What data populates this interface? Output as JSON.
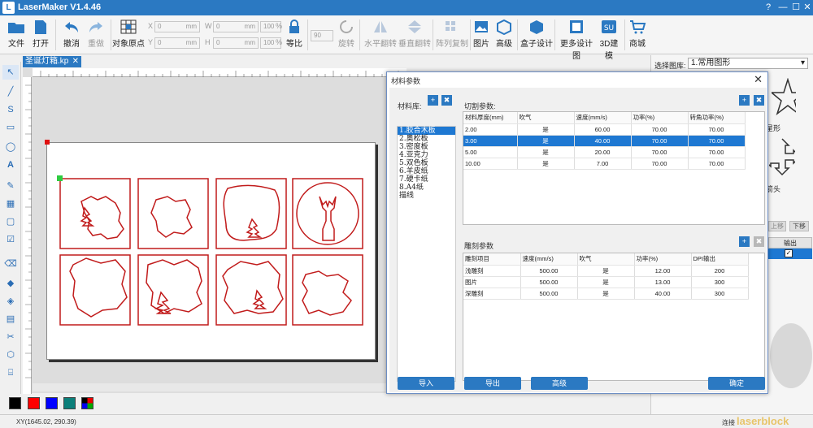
{
  "app": {
    "title": "LaserMaker V1.4.46",
    "logo": "L"
  },
  "window_buttons": [
    "?",
    "—",
    "☐",
    "✕"
  ],
  "toolbar": {
    "file": "文件",
    "open": "打开",
    "undo": "撤消",
    "redo": "重做",
    "origin": "对象原点",
    "x_label": "X",
    "y_label": "Y",
    "w_label": "W",
    "h_label": "H",
    "x_val": "0",
    "y_val": "0",
    "w_val": "0",
    "h_val": "0",
    "unit_mm": "mm",
    "pct_val": "100",
    "unit_pct": "%",
    "equal": "等比",
    "rotate_val": "90",
    "rotate": "旋转",
    "hflip": "水平翻转",
    "vflip": "垂直翻转",
    "array": "阵列复制",
    "image": "图片",
    "advanced": "高级",
    "box": "盒子设计",
    "more": "更多设计图",
    "model3d": "3D建模",
    "shop": "商城"
  },
  "document": {
    "tab": "圣诞灯箱.kp",
    "close": "✕"
  },
  "colors": {
    "swatches": [
      "#000000",
      "#ff0000",
      "#0000ff",
      "#0c7f7a"
    ],
    "accent": "#2b79c2",
    "shape": "#c11b1b"
  },
  "status": {
    "coords": "XY(1645.02, 290.39)",
    "connect": "连接",
    "watermark": "laserblock"
  },
  "library": {
    "select_label": "选择图库:",
    "select_value": "1.常用图形",
    "star": "星形",
    "arrow": "箭头",
    "up": "上移",
    "down": "下移",
    "output": "输出"
  },
  "dialog": {
    "title": "材料参数",
    "close": "✕",
    "library_label": "材料库:",
    "plus": "+",
    "cut_label": "切割参数:",
    "engrave_label": "雕刻参数",
    "materials": [
      "1.胶合木板",
      "2.奥松板",
      "3.密度板",
      "4.亚克力",
      "5.双色板",
      "6.羊皮纸",
      "7.硬卡纸",
      "8.A4纸",
      "描线"
    ],
    "cut": {
      "headers": [
        "材料厚度(mm)",
        "吹气",
        "速度(mm/s)",
        "功率(%)",
        "转角功率(%)"
      ],
      "rows": [
        [
          "2.00",
          "是",
          "60.00",
          "70.00",
          "70.00"
        ],
        [
          "3.00",
          "是",
          "40.00",
          "70.00",
          "70.00"
        ],
        [
          "5.00",
          "是",
          "20.00",
          "70.00",
          "70.00"
        ],
        [
          "10.00",
          "是",
          "7.00",
          "70.00",
          "70.00"
        ]
      ]
    },
    "engrave": {
      "headers": [
        "雕刻项目",
        "速度(mm/s)",
        "吹气",
        "功率(%)",
        "DPI输出"
      ],
      "rows": [
        [
          "浅雕刻",
          "500.00",
          "是",
          "12.00",
          "200"
        ],
        [
          "图片",
          "500.00",
          "是",
          "13.00",
          "300"
        ],
        [
          "深雕刻",
          "500.00",
          "是",
          "40.00",
          "300"
        ]
      ]
    },
    "buttons": {
      "import": "导入",
      "export": "导出",
      "advanced": "高级",
      "ok": "确定"
    }
  }
}
